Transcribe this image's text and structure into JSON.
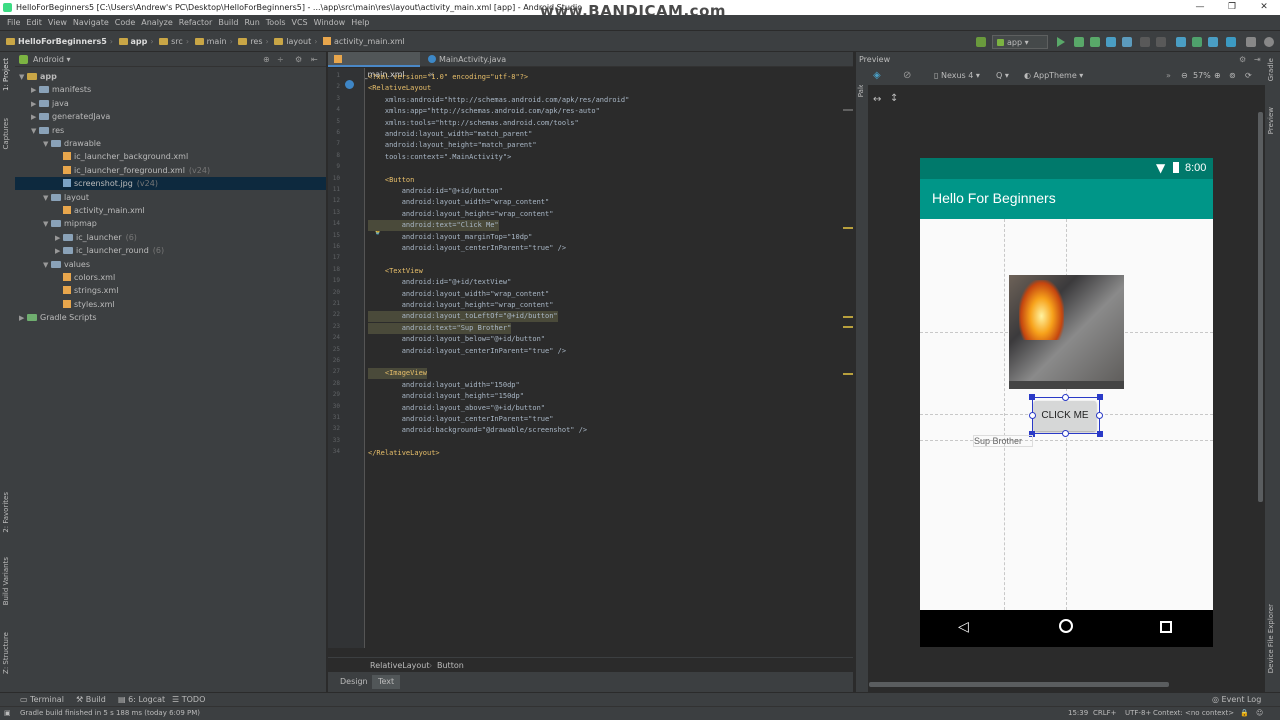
{
  "window": {
    "title": "HelloForBeginners5 [C:\\Users\\Andrew's PC\\Desktop\\HelloForBeginners5] - ...\\app\\src\\main\\res\\layout\\activity_main.xml [app] - Android Studio",
    "watermark": "www.BANDICAM.com"
  },
  "menu": [
    "File",
    "Edit",
    "View",
    "Navigate",
    "Code",
    "Analyze",
    "Refactor",
    "Build",
    "Run",
    "Tools",
    "VCS",
    "Window",
    "Help"
  ],
  "breadcrumb": [
    "HelloForBeginners5",
    "app",
    "src",
    "main",
    "res",
    "layout",
    "activity_main.xml"
  ],
  "toolbar": {
    "run_config": "app"
  },
  "project": {
    "view_mode": "Android",
    "tree": [
      {
        "label": "app",
        "type": "folder",
        "arrow": "▼"
      },
      {
        "label": "manifests",
        "type": "folder",
        "arrow": "▶"
      },
      {
        "label": "java",
        "type": "folder",
        "arrow": "▶"
      },
      {
        "label": "generatedJava",
        "type": "folder",
        "arrow": "▶"
      },
      {
        "label": "res",
        "type": "folder",
        "arrow": "▼"
      },
      {
        "label": "drawable",
        "type": "folder",
        "arrow": "▼"
      },
      {
        "label": "ic_launcher_background.xml",
        "type": "xml",
        "arrow": ""
      },
      {
        "label": "ic_launcher_foreground.xml",
        "type": "xml",
        "arrow": "",
        "suffix": "(v24)"
      },
      {
        "label": "screenshot.jpg",
        "type": "img",
        "arrow": "",
        "suffix": "(v24)"
      },
      {
        "label": "layout",
        "type": "folder",
        "arrow": "▼"
      },
      {
        "label": "activity_main.xml",
        "type": "xml",
        "arrow": ""
      },
      {
        "label": "mipmap",
        "type": "folder",
        "arrow": "▼"
      },
      {
        "label": "ic_launcher",
        "type": "folder",
        "arrow": "▶",
        "suffix": "(6)"
      },
      {
        "label": "ic_launcher_round",
        "type": "folder",
        "arrow": "▶",
        "suffix": "(6)"
      },
      {
        "label": "values",
        "type": "folder",
        "arrow": "▼"
      },
      {
        "label": "colors.xml",
        "type": "xml",
        "arrow": ""
      },
      {
        "label": "strings.xml",
        "type": "xml",
        "arrow": ""
      },
      {
        "label": "styles.xml",
        "type": "xml",
        "arrow": ""
      },
      {
        "label": "Gradle Scripts",
        "type": "gradle",
        "arrow": "▶"
      }
    ]
  },
  "editor": {
    "tabs": [
      "activity_main.xml",
      "MainActivity.java"
    ],
    "lines": [
      {
        "num": "1",
        "text": "<?xml version=\"1.0\" encoding=\"utf-8\"?>"
      },
      {
        "num": "2",
        "text": "<RelativeLayout"
      },
      {
        "num": "3",
        "text": "    xmlns:android=\"http://schemas.android.com/apk/res/android\""
      },
      {
        "num": "4",
        "text": "    xmlns:app=\"http://schemas.android.com/apk/res-auto\""
      },
      {
        "num": "5",
        "text": "    xmlns:tools=\"http://schemas.android.com/tools\""
      },
      {
        "num": "6",
        "text": "    android:layout_width=\"match_parent\""
      },
      {
        "num": "7",
        "text": "    android:layout_height=\"match_parent\""
      },
      {
        "num": "8",
        "text": "    tools:context=\".MainActivity\">"
      },
      {
        "num": "9",
        "text": ""
      },
      {
        "num": "10",
        "text": "    <Button"
      },
      {
        "num": "11",
        "text": "        android:id=\"@+id/button\""
      },
      {
        "num": "12",
        "text": "        android:layout_width=\"wrap_content\""
      },
      {
        "num": "13",
        "text": "        android:layout_height=\"wrap_content\""
      },
      {
        "num": "14",
        "text": "        android:text=\"Click Me\""
      },
      {
        "num": "15",
        "text": "        android:layout_marginTop=\"10dp\""
      },
      {
        "num": "16",
        "text": "        android:layout_centerInParent=\"true\" />"
      },
      {
        "num": "17",
        "text": ""
      },
      {
        "num": "18",
        "text": "    <TextView"
      },
      {
        "num": "19",
        "text": "        android:id=\"@+id/textView\""
      },
      {
        "num": "20",
        "text": "        android:layout_width=\"wrap_content\""
      },
      {
        "num": "21",
        "text": "        android:layout_height=\"wrap_content\""
      },
      {
        "num": "22",
        "text": "        android:layout_toLeftOf=\"@+id/button\""
      },
      {
        "num": "23",
        "text": "        android:text=\"Sup Brother\""
      },
      {
        "num": "24",
        "text": "        android:layout_below=\"@+id/button\""
      },
      {
        "num": "25",
        "text": "        android:layout_centerInParent=\"true\" />"
      },
      {
        "num": "26",
        "text": ""
      },
      {
        "num": "27",
        "text": "    <ImageView"
      },
      {
        "num": "28",
        "text": "        android:layout_width=\"150dp\""
      },
      {
        "num": "29",
        "text": "        android:layout_height=\"150dp\""
      },
      {
        "num": "30",
        "text": "        android:layout_above=\"@+id/button\""
      },
      {
        "num": "31",
        "text": "        android:layout_centerInParent=\"true\""
      },
      {
        "num": "32",
        "text": "        android:background=\"@drawable/screenshot\" />"
      },
      {
        "num": "33",
        "text": ""
      },
      {
        "num": "34",
        "text": "</RelativeLayout>"
      }
    ],
    "breadcrumb": [
      "RelativeLayout",
      "Button"
    ],
    "mode_tabs": [
      "Design",
      "Text"
    ]
  },
  "preview": {
    "title": "Preview",
    "device": "Nexus 4",
    "api": "Q",
    "theme": "AppTheme",
    "zoom": "57%",
    "phone": {
      "time": "8:00",
      "app_title": "Hello For Beginners",
      "button_text": "CLICK ME",
      "text_view": "Sup Brother"
    }
  },
  "side_labels": {
    "left": [
      "1: Project",
      "Captures",
      "2: Favorites",
      "Build Variants",
      "Z: Structure"
    ],
    "right": [
      "Gradle",
      "Preview",
      "Device File Explorer"
    ],
    "palette": "Palette"
  },
  "bottom_tabs": [
    "Terminal",
    "Build",
    "6: Logcat",
    "TODO"
  ],
  "event_log": "Event Log",
  "status": {
    "message": "Gradle build finished in 5 s 188 ms (today 6:09 PM)",
    "position": "15:39",
    "line_sep": "CRLF+",
    "encoding": "UTF-8+",
    "context": "Context: <no context>"
  }
}
